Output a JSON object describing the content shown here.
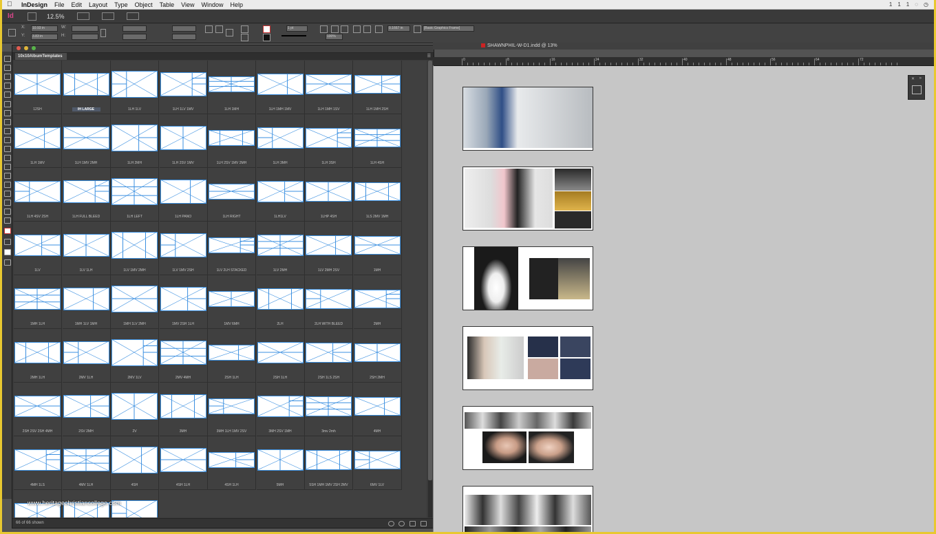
{
  "menubar": {
    "app": "InDesign",
    "items": [
      "File",
      "Edit",
      "Layout",
      "Type",
      "Object",
      "Table",
      "View",
      "Window",
      "Help"
    ],
    "right_status": [
      "1",
      "1",
      "1"
    ]
  },
  "appbar": {
    "logo": "Id",
    "zoom": "12.5%"
  },
  "control": {
    "x_label": "X:",
    "y_label": "Y:",
    "w_label": "W:",
    "h_label": "H:",
    "x_value": "10.93 in",
    "y_value": "3.83 in",
    "stroke_weight": "1 pt",
    "scale": "100%",
    "dimension": "0.1667 in",
    "frame_style": "[Basic Graphics Frame]"
  },
  "library": {
    "tab_label": "10x10AlbumTemplates",
    "status": "66 of 66 shown",
    "items": [
      "12SH",
      "IH LARGE",
      "1LH 1LV",
      "1LH 1LV 1MV",
      "1LH 1MH",
      "1LH 1MH 1MV",
      "1LH 1MH 1SV",
      "1LH 1MH 2SH",
      "1LH 1MV",
      "1LH 1MV 2MH",
      "1LH 2MH",
      "1LH 2SV 1MV",
      "1LH 2SV 1MV 2MH",
      "1LH 3MH",
      "1LH 3SH",
      "1LH 4SH",
      "1LH 4SV 2SH",
      "1LH FULL BLEED",
      "1LH LEFT",
      "1LH PANO",
      "1LH RIGHT",
      "1LH1LV",
      "1LHP 4SH",
      "1LS 2MV 1MH",
      "1LV",
      "1LV 1LH",
      "1LV 1MV 2MH",
      "1LV 1MV 2SH",
      "1LV 2LH STACKED",
      "1LV 2MH",
      "1LV 2MH 2SV",
      "1MH",
      "1MH 1LH",
      "1MH 1LV 1MH",
      "1MH 1LV 2MH",
      "1MV 2SH 1LH",
      "1MV 6MH",
      "2LH",
      "2LH WITH BLEED",
      "2MH",
      "2MH 1LH",
      "2MV 1LH",
      "2MV 1LV",
      "2MV 4MH",
      "2SH 1LH",
      "2SH 1LH",
      "2SH 1LS 2SH",
      "2SH 2MH",
      "2SH 2SV 2SH 4MH",
      "2SV 2MH",
      "2V",
      "3MH",
      "3MH 1LH 1MV 2SV",
      "3MH 2SV 1MH",
      "3mv 2mh",
      "4MH",
      "4MH 1LS",
      "4MV 1LH",
      "4SH",
      "4SH 1LH",
      "4SH 1LH",
      "5MH",
      "5SH 1MH 1MV 2SH 2MV",
      "6MV 1LV",
      "",
      "",
      ""
    ],
    "selected_index": 1
  },
  "document": {
    "title": "SHAWNPHIL-W-D1.indd @ 13%",
    "ruler_numbers": [
      "0",
      "8",
      "16",
      "24",
      "32",
      "40",
      "48",
      "56",
      "64",
      "72"
    ]
  },
  "watermark": "www.heritagechristiancollege.com",
  "colors": {
    "accent_frame": "#3a8fe0",
    "screen_border": "#e8c830",
    "canvas": "#c6c6c6"
  }
}
